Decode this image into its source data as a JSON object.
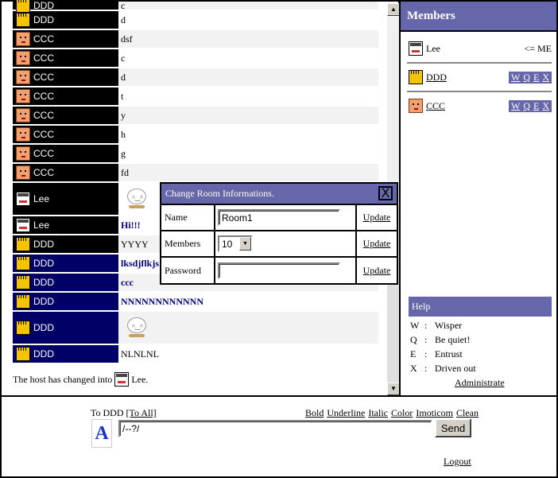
{
  "chat": {
    "rows": [
      {
        "user": "DDD",
        "avatar": "yellow",
        "msg": "c"
      },
      {
        "user": "DDD",
        "avatar": "yellow",
        "msg": "d"
      },
      {
        "user": "CCC",
        "avatar": "orange",
        "msg": "dsf"
      },
      {
        "user": "CCC",
        "avatar": "orange",
        "msg": "c"
      },
      {
        "user": "CCC",
        "avatar": "orange",
        "msg": "d"
      },
      {
        "user": "CCC",
        "avatar": "orange",
        "msg": "t"
      },
      {
        "user": "CCC",
        "avatar": "orange",
        "msg": "y"
      },
      {
        "user": "CCC",
        "avatar": "orange",
        "msg": "h"
      },
      {
        "user": "CCC",
        "avatar": "orange",
        "msg": "g"
      },
      {
        "user": "CCC",
        "avatar": "orange",
        "msg": "fd"
      },
      {
        "user": "Lee",
        "avatar": "lee",
        "msg": ""
      },
      {
        "user": "Lee",
        "avatar": "lee",
        "msg": "Hi!!!"
      },
      {
        "user": "DDD",
        "avatar": "yellow",
        "msg": "YYYY"
      },
      {
        "user": "DDD",
        "avatar": "yellow",
        "msg": "lksdjflkjs"
      },
      {
        "user": "DDD",
        "avatar": "yellow",
        "msg": "ccc"
      },
      {
        "user": "DDD",
        "avatar": "yellow",
        "msg": "NNNNNNNNNNNN"
      },
      {
        "user": "DDD",
        "avatar": "yellow",
        "msg": ""
      },
      {
        "user": "DDD",
        "avatar": "yellow",
        "msg": "NLNLNL"
      }
    ],
    "system_prefix": "The host has changed into",
    "system_user": "Lee."
  },
  "dialog": {
    "title": "Change Room Informations.",
    "close": "X",
    "name_label": "Name",
    "name_value": "Room1",
    "members_label": "Members",
    "members_value": "10",
    "password_label": "Password",
    "password_value": "",
    "update": "Update"
  },
  "members": {
    "title": "Members",
    "list": [
      {
        "name": "Lee",
        "avatar": "lee",
        "tag": "<= ME"
      },
      {
        "name": "DDD",
        "avatar": "yellow"
      },
      {
        "name": "CCC",
        "avatar": "orange"
      }
    ],
    "actions": [
      "W",
      "Q",
      "E",
      "X"
    ]
  },
  "help": {
    "title": "Help",
    "lines": [
      {
        "key": "W",
        "colon": ":",
        "text": "Wisper"
      },
      {
        "key": "Q",
        "colon": ":",
        "text": "Be quiet!"
      },
      {
        "key": "E",
        "colon": ":",
        "text": "Entrust"
      },
      {
        "key": "X",
        "colon": ":",
        "text": "Driven out"
      }
    ],
    "admin": "Administrate"
  },
  "input": {
    "to_prefix": "To DDD",
    "to_all": "[To All]",
    "format": [
      "Bold",
      "Underline",
      "Italic",
      "Color",
      "Imoticom",
      "Clean"
    ],
    "font_icon": "A",
    "message": "/--?/",
    "send": "Send",
    "logout": "Logout"
  },
  "colors": {
    "accent": "#6666aa",
    "navy": "#000066"
  }
}
